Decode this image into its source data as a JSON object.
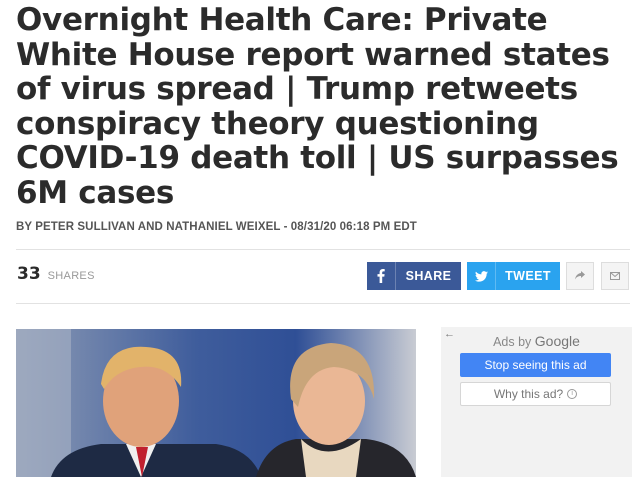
{
  "article": {
    "headline": "Overnight Health Care: Private White House report warned states of virus spread | Trump retweets conspiracy theory questioning COVID-19 death toll | US surpasses 6M cases",
    "byline": "BY PETER SULLIVAN AND NATHANIEL WEIXEL - 08/31/20 06:18 PM EDT"
  },
  "share_bar": {
    "count": "33",
    "count_label": "SHARES",
    "facebook_label": "SHARE",
    "twitter_label": "TWEET",
    "icons": [
      "facebook-icon",
      "twitter-icon",
      "forward-icon",
      "mail-icon"
    ],
    "colors": {
      "facebook": "#3b5998",
      "twitter": "#2aa3ef"
    }
  },
  "ad": {
    "ads_by": "Ads by",
    "google": "Google",
    "stop_label": "Stop seeing this ad",
    "why_label": "Why this ad?",
    "back_icon": "back-arrow-icon",
    "info_icon": "info-icon",
    "accent": "#4285f4"
  }
}
